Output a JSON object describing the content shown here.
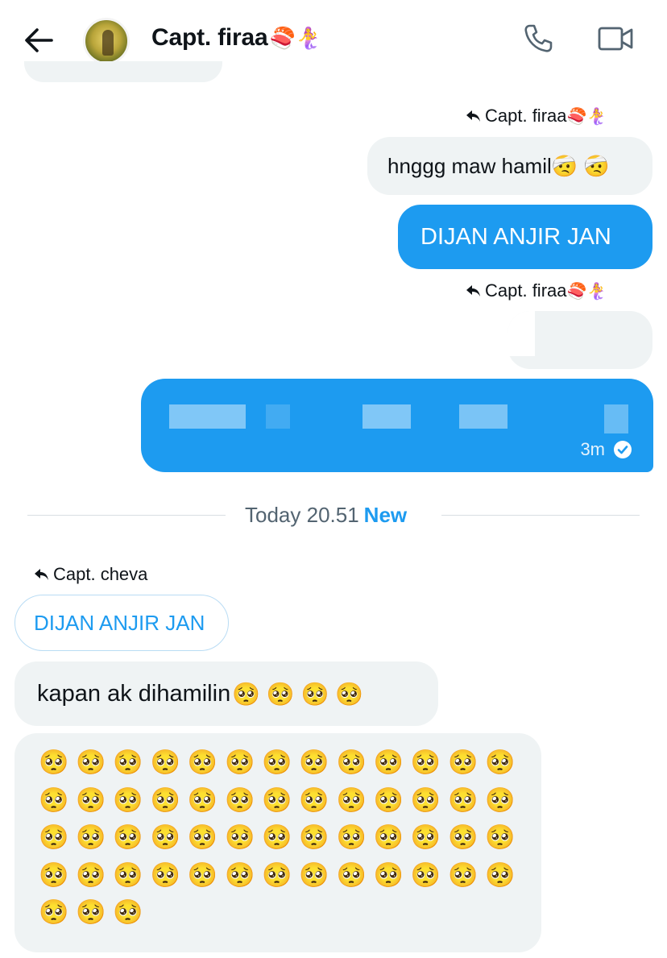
{
  "header": {
    "title": "Capt. firaa",
    "title_emojis": "🍣🧜‍♀️",
    "back_icon": "arrow-left-icon",
    "call_icon": "phone-icon",
    "video_icon": "video-camera-icon"
  },
  "messages": [
    {
      "id": "m1",
      "side": "right",
      "reply_to": "Capt. firaa",
      "reply_to_emojis": "🍣🧜‍♀️",
      "text": "hnggg maw hamil🤕 🤕",
      "style": "gray"
    },
    {
      "id": "m2",
      "side": "right",
      "text": "DIJAN ANJIR JAN",
      "style": "blue"
    },
    {
      "id": "m3",
      "side": "right",
      "reply_to": "Capt. firaa",
      "reply_to_emojis": "🍣🧜‍♀️",
      "text": "",
      "style": "gray-blurred"
    },
    {
      "id": "m4",
      "side": "right",
      "text": "",
      "style": "blue-blurred",
      "time": "3m",
      "status": "read"
    }
  ],
  "divider": {
    "time": "Today 20.51",
    "new_label": "New"
  },
  "incoming": {
    "reply_to": "Capt. cheva",
    "quoted_text": "DIJAN ANJIR JAN",
    "message1": {
      "text": "kapan ak dihamilin",
      "emojis": "🥺 🥺 🥺 🥺"
    },
    "message2": {
      "emoji": "🥺",
      "count": 55
    }
  },
  "colors": {
    "accent": "#1d9bf0",
    "bubble_gray": "#eff3f4",
    "text_secondary": "#536471"
  }
}
